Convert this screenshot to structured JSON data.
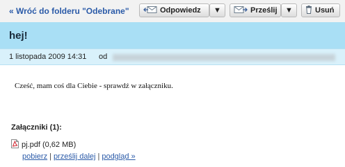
{
  "toolbar": {
    "back_label": "« Wróć do folderu \"Odebrane\"",
    "reply_label": "Odpowiedz",
    "forward_label": "Prześlij",
    "delete_label": "Usuń",
    "dropdown_glyph": "▼"
  },
  "message": {
    "subject": "hej!",
    "date": "1 listopada 2009 14:31",
    "from_label": "od",
    "body": "Cześć, mam coś dla Ciebie - sprawdź w załączniku."
  },
  "attachments": {
    "title": "Załączniki (1):",
    "file": "pj.pdf (0,62 MB)",
    "actions": {
      "download": "pobierz",
      "forward": "prześlij dalej",
      "preview": "podgląd »",
      "separator": "|"
    }
  },
  "colors": {
    "subject_bar": "#a9dff5",
    "meta_bar": "#d9f1fb",
    "link": "#2a5aa8",
    "toolbar": "#f2f2f2"
  }
}
